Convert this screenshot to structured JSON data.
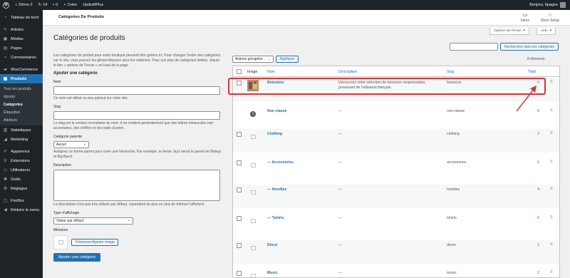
{
  "adminbar": {
    "site_name": "Démo 2",
    "updates_count": "14",
    "comments_count": "0",
    "new_label": "Créer",
    "plugin_label": "UpdraftPlus",
    "greeting": "Bonjour, bpages"
  },
  "sidebar": {
    "items": [
      {
        "label": "Tableau de bord",
        "icon": "dashboard-icon"
      },
      {
        "label": "Articles",
        "icon": "pin-icon"
      },
      {
        "label": "Médias",
        "icon": "media-icon"
      },
      {
        "label": "Pages",
        "icon": "page-icon"
      },
      {
        "label": "Commentaires",
        "icon": "comment-icon"
      },
      {
        "label": "WooCommerce",
        "icon": "woo-icon"
      },
      {
        "label": "Produits",
        "icon": "archive-icon"
      },
      {
        "label": "Statistiques",
        "icon": "chart-icon"
      },
      {
        "label": "Marketing",
        "icon": "megaphone-icon"
      },
      {
        "label": "Apparence",
        "icon": "brush-icon"
      },
      {
        "label": "Extensions",
        "icon": "plugin-icon"
      },
      {
        "label": "Utilisateurs",
        "icon": "users-icon"
      },
      {
        "label": "Outils",
        "icon": "tools-icon"
      },
      {
        "label": "Réglages",
        "icon": "settings-icon"
      },
      {
        "label": "FooBox",
        "icon": "box-icon"
      },
      {
        "label": "Réduire le menu",
        "icon": "collapse-icon"
      }
    ],
    "submenu": [
      "Tous les produits",
      "Ajouter",
      "Catégories",
      "Étiquettes",
      "Attributs"
    ]
  },
  "header": {
    "title": "Catégories De Produits",
    "inbox_label": "Inbox",
    "store_setup_label": "Store Setup",
    "screen_options_label": "Options de l'écran",
    "help_label": "Aide"
  },
  "page": {
    "title": "Catégories de produits",
    "search_button": "Rechercher dans les catégories",
    "count": "8 éléments"
  },
  "form": {
    "intro": "Les catégories de produit pour votre boutique peuvent être gérées ici. Pour changer l'ordre des catégories sur le site, vous pouvez les glisser/déposer pour les ordonner. Pour voir plus de catégories listées, cliquer le lien « options de l'écran » en haut de la page.",
    "heading": "Ajouter une catégorie",
    "name_label": "Nom",
    "name_help": "Ce nom est utilisé un peu partout sur votre site.",
    "slug_label": "Slug",
    "slug_help": "Le slug est la version normalisée du nom. Il ne contient généralement que des lettres minuscules non accentuées, des chiffres et des traits d'union.",
    "parent_label": "Catégorie parente",
    "parent_value": "Aucun",
    "parent_help": "Assignez un terme parent pour créer une hiérarchie. Par exemple, le terme Jazz serait le parent de Bebop et Big Band.",
    "description_label": "Description",
    "description_help": "La description n'est pas très utilisée par défaut, cependant de plus en plus de thèmes l'affichent.",
    "display_label": "Type d'affichage",
    "display_value": "Valeur par défaut",
    "thumbnail_label": "Miniature",
    "upload_button": "Téléverser/Ajouter image",
    "submit_button": "Ajouter une catégorie"
  },
  "table": {
    "bulk_actions": "Actions groupées",
    "apply_button": "Appliquer",
    "columns": {
      "image": "Image",
      "name": "Nom",
      "description": "Description",
      "slug": "Slug",
      "total": "Total"
    },
    "rows": [
      {
        "name": "Boissons",
        "description": "Découvrez notre sélection de boissons responsables, provenant de l'artisanat français.",
        "slug": "boissons",
        "count": "0"
      },
      {
        "name": "Non classé",
        "description": "—",
        "slug": "non-classe",
        "count": "0"
      },
      {
        "name": "Clothing",
        "description": "—",
        "slug": "clothing",
        "count": "2"
      },
      {
        "name": "— Accessories",
        "description": "—",
        "slug": "accessories",
        "count": "5"
      },
      {
        "name": "— Hoodies",
        "description": "—",
        "slug": "hoodies",
        "count": "4"
      },
      {
        "name": "— Tshirts",
        "description": "—",
        "slug": "tshirts",
        "count": "6"
      },
      {
        "name": "Décor",
        "description": "—",
        "slug": "decor",
        "count": "1"
      },
      {
        "name": "Music",
        "description": "—",
        "slug": "music",
        "count": "2"
      }
    ]
  },
  "colors": {
    "accent": "#2271b1",
    "highlight": "#d63638",
    "sidebar": "#1d2327"
  }
}
